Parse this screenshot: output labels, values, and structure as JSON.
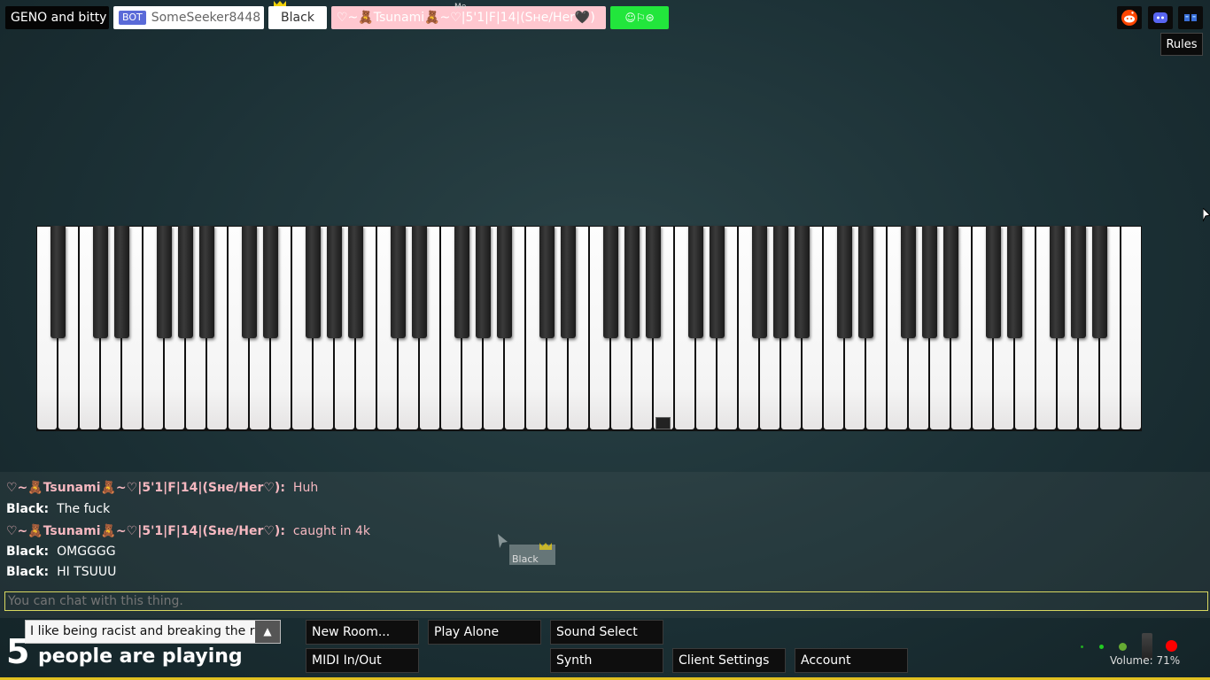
{
  "players": [
    {
      "name": "GENO and bitty"
    },
    {
      "bot_label": "BOT",
      "name": "SomeSeeker8448"
    },
    {
      "name": "Black"
    },
    {
      "name": "♡~🧸Tsunami🧸~♡|5'1|F|14|(Sʜe/Her🖤)",
      "me_label": "Me"
    },
    {
      "name": "☺⚐⊜"
    }
  ],
  "top_right": {
    "rules_label": "Rules",
    "icons": [
      "reddit-icon",
      "discord-icon",
      "website-icon"
    ]
  },
  "chat": {
    "messages": [
      {
        "nick": "♡~🧸Tsunami🧸~♡|5'1|F|14|(Sʜe/Her♡):",
        "text": "Huh"
      },
      {
        "nick": "Black:",
        "text": "The fuck"
      },
      {
        "nick": "♡~🧸Tsunami🧸~♡|5'1|F|14|(Sʜe/Her♡):",
        "text": "caught in 4k"
      },
      {
        "nick": "Black:",
        "text": "OMGGGG"
      },
      {
        "nick": "Black:",
        "text": "HI TSUUU"
      }
    ],
    "placeholder": "You can chat with this thing.",
    "ghost_cursor_name": "Black"
  },
  "bottom": {
    "room_name": "I like being racist and breaking the rules",
    "player_count": "5",
    "player_count_label": "people are playing",
    "buttons": {
      "new_room": "New Room...",
      "play_alone": "Play Alone",
      "sound_select": "Sound Select",
      "midi": "MIDI In/Out",
      "synth": "Synth",
      "client_settings": "Client Settings",
      "account": "Account"
    },
    "volume_label": "Volume: 71%"
  },
  "colors": {
    "my_name_bg": "#ffc7cf",
    "my_name_text": "#ffffff",
    "chat_pink": "#f6b8c0",
    "green_button": "#22e63c",
    "bot_badge": "#5a6ad8",
    "crown": "#f2d20a"
  }
}
